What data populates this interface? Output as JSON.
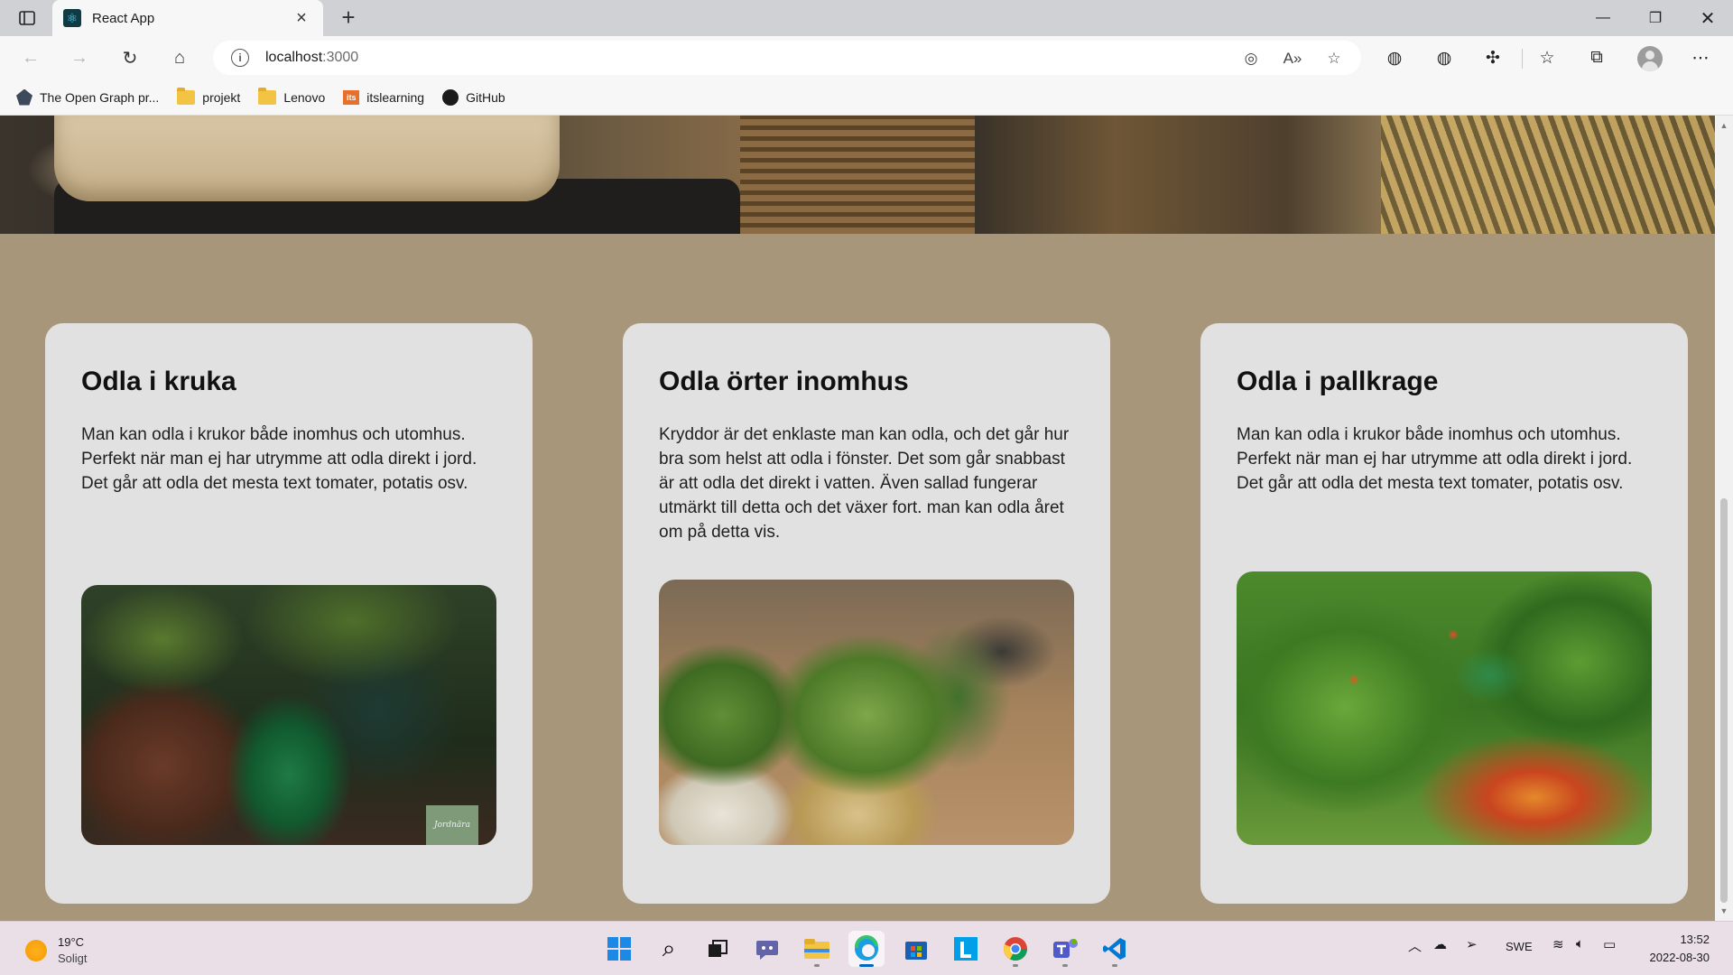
{
  "browser": {
    "tab_title": "React App",
    "url_host": "localhost",
    "url_port": ":3000",
    "bookmarks": [
      {
        "label": "The Open Graph pr...",
        "icon": "opengraph-icon"
      },
      {
        "label": "projekt",
        "icon": "folder-icon"
      },
      {
        "label": "Lenovo",
        "icon": "folder-icon"
      },
      {
        "label": "itslearning",
        "icon": "itslearning-icon"
      },
      {
        "label": "GitHub",
        "icon": "github-icon"
      }
    ],
    "itslearning_badge": "its",
    "accent_color": "#0067c0"
  },
  "page": {
    "background_color": "#a8967a",
    "card_color": "#e1e1e1",
    "cards": [
      {
        "title": "Odla i kruka",
        "text": "Man kan odla i krukor både inomhus och utomhus. Perfekt när man ej har utrymme att odla direkt i jord. Det går att odla det mesta text tomater, potatis osv.",
        "image_logo": "Jordnära"
      },
      {
        "title": "Odla örter inomhus",
        "text": "Kryddor är det enklaste man kan odla, och det går hur bra som helst att odla i fönster. Det som går snabbast är att odla det direkt i vatten. Även sallad fungerar utmärkt till detta och det växer fort. man kan odla året om på detta vis."
      },
      {
        "title": "Odla i pallkrage",
        "text": "Man kan odla i krukor både inomhus och utomhus. Perfekt när man ej har utrymme att odla direkt i jord. Det går att odla det mesta text tomater, potatis osv."
      }
    ]
  },
  "taskbar": {
    "weather_temp": "19°C",
    "weather_condition": "Soligt",
    "language": "SWE",
    "time": "13:52",
    "date": "2022-08-30"
  }
}
